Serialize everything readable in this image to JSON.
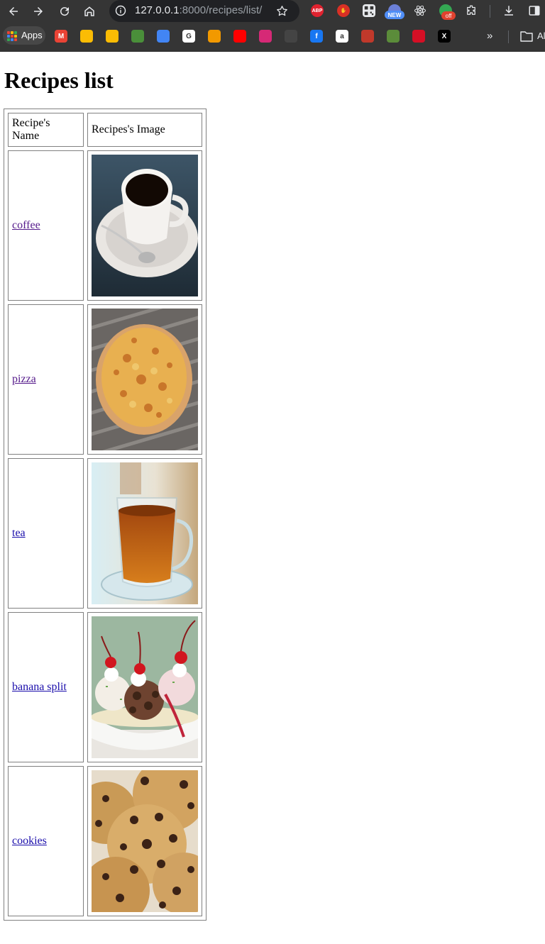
{
  "browser": {
    "url_host": "127.0.0.1",
    "url_rest": ":8000/recipes/list/",
    "extensions": [
      {
        "name": "adblock-plus-icon",
        "text": "ABP",
        "color": "#e0222f"
      },
      {
        "name": "stop-hand-icon",
        "text": "",
        "color": "#d93025"
      },
      {
        "name": "qr-code-icon",
        "text": "",
        "color": "#e8eaed"
      },
      {
        "name": "new-badge-extension-icon",
        "text": "",
        "color": "#6b7fd6"
      },
      {
        "name": "react-devtools-icon",
        "text": "",
        "color": "#61dafb"
      },
      {
        "name": "green-extension-icon",
        "text": "",
        "color": "#34a853"
      }
    ],
    "new_badge": "NEW",
    "off_badge": "off"
  },
  "bookmarks": {
    "apps_label": "Apps",
    "items": [
      {
        "name": "gmail-icon",
        "text": "M",
        "color": "#ea4335"
      },
      {
        "name": "google-drive-icon",
        "text": "",
        "color": "#fbbc04"
      },
      {
        "name": "google-keep-icon",
        "text": "",
        "color": "#fbbc04"
      },
      {
        "name": "bookmark-icon-4",
        "text": "",
        "color": "#4a8f3a"
      },
      {
        "name": "google-translate-icon",
        "text": "",
        "color": "#4285f4"
      },
      {
        "name": "google-icon",
        "text": "G",
        "color": "#ffffff"
      },
      {
        "name": "bookmark-icon-7",
        "text": "",
        "color": "#f29900"
      },
      {
        "name": "youtube-icon",
        "text": "",
        "color": "#ff0000"
      },
      {
        "name": "instagram-icon",
        "text": "",
        "color": "#d62976"
      },
      {
        "name": "bookmark-icon-10",
        "text": "",
        "color": "#444444"
      },
      {
        "name": "facebook-icon",
        "text": "f",
        "color": "#1877f2"
      },
      {
        "name": "amazon-icon",
        "text": "a",
        "color": "#ffffff"
      },
      {
        "name": "bookmark-icon-13",
        "text": "",
        "color": "#c0392b"
      },
      {
        "name": "bookmark-icon-14",
        "text": "",
        "color": "#5b8c3a"
      },
      {
        "name": "bookmark-icon-15",
        "text": "",
        "color": "#d50f25"
      },
      {
        "name": "x-twitter-icon",
        "text": "X",
        "color": "#000000"
      }
    ],
    "folder_label": "Al"
  },
  "page": {
    "title": "Recipes list",
    "columns": [
      "Recipe's Name",
      "Recipes's Image"
    ],
    "recipes": [
      {
        "name": "coffee",
        "image_icon": "coffee-cup-image",
        "visited": true
      },
      {
        "name": "pizza",
        "image_icon": "pizza-image",
        "visited": true
      },
      {
        "name": "tea",
        "image_icon": "tea-glass-image",
        "visited": false
      },
      {
        "name": "banana split",
        "image_icon": "banana-split-image",
        "visited": false
      },
      {
        "name": "cookies",
        "image_icon": "cookies-image",
        "visited": false
      }
    ]
  }
}
